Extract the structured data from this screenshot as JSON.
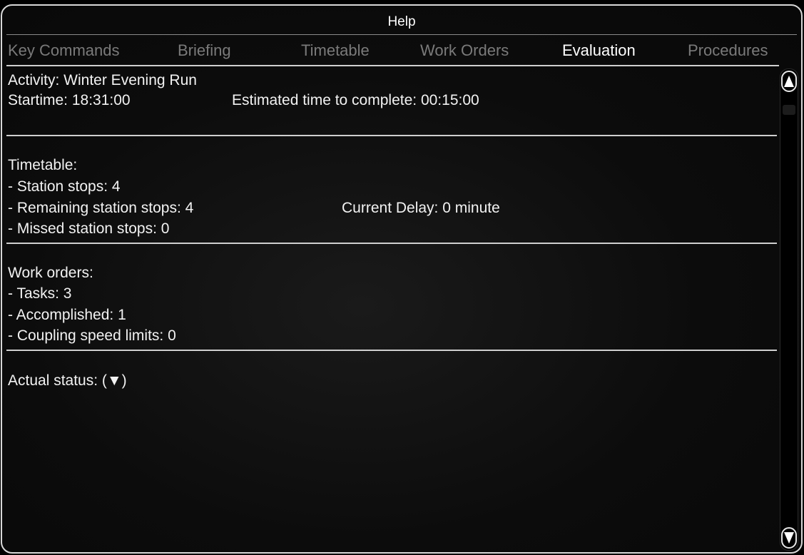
{
  "window": {
    "title": "Help"
  },
  "tabs": [
    {
      "label": "Key Commands",
      "active": false
    },
    {
      "label": "Briefing",
      "active": false
    },
    {
      "label": "Timetable",
      "active": false
    },
    {
      "label": "Work Orders",
      "active": false
    },
    {
      "label": "Evaluation",
      "active": true
    },
    {
      "label": "Procedures",
      "active": false
    }
  ],
  "evaluation": {
    "activity": "Activity: Winter Evening Run",
    "starttime": "Startime: 18:31:00",
    "estimated": "Estimated time to complete: 00:15:00",
    "timetable": {
      "heading": "Timetable:",
      "station_stops": "- Station stops: 4",
      "remaining_stops": "- Remaining station stops: 4",
      "current_delay": "Current Delay: 0 minute",
      "missed_stops": "- Missed station stops: 0"
    },
    "work_orders": {
      "heading": "Work orders:",
      "tasks": "- Tasks: 3",
      "accomplished": "- Accomplished: 1",
      "coupling_limits": "- Coupling speed limits: 0"
    },
    "actual_status": "Actual status: (▼)"
  }
}
